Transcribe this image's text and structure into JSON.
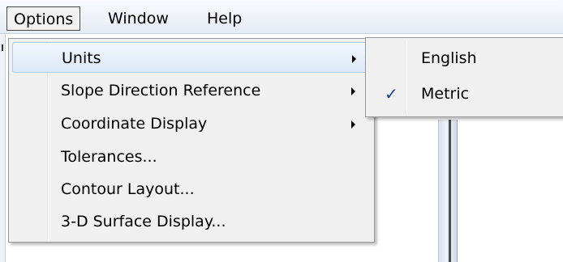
{
  "menubar": {
    "items": [
      {
        "label": "Options"
      },
      {
        "label": "Window"
      },
      {
        "label": "Help"
      }
    ]
  },
  "options_menu": {
    "items": [
      {
        "label": "Units",
        "has_submenu": true,
        "highlighted": true
      },
      {
        "label": "Slope Direction Reference",
        "has_submenu": true
      },
      {
        "label": "Coordinate Display",
        "has_submenu": true
      },
      {
        "label": "Tolerances..."
      },
      {
        "label": "Contour Layout..."
      },
      {
        "label": "3-D Surface Display..."
      }
    ]
  },
  "units_submenu": {
    "items": [
      {
        "label": "English",
        "checked": false
      },
      {
        "label": "Metric",
        "checked": true,
        "check_icon": "✓"
      }
    ]
  },
  "icons": {
    "submenu_arrow": "chevron-right-icon",
    "check": "checkmark-icon"
  },
  "colors": {
    "highlight_border": "#aecbee",
    "check": "#1b3f91"
  }
}
